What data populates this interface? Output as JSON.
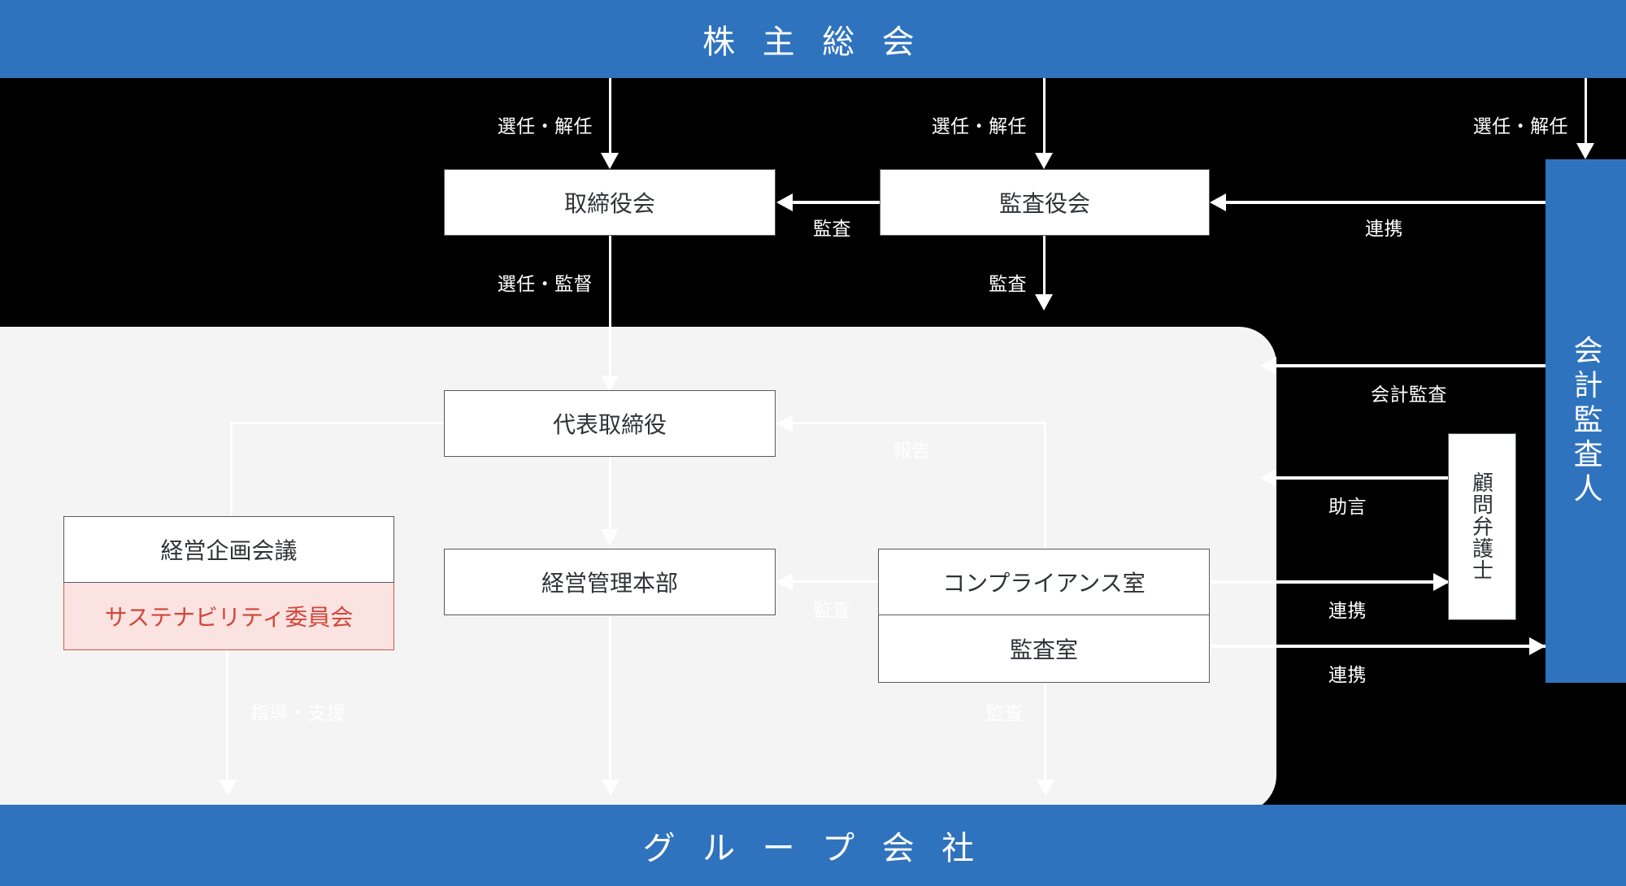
{
  "diagram": {
    "title_top": "株 主 総 会",
    "title_bottom": "グ ル ー プ 会 社",
    "accountant_panel": "会計監査人",
    "nodes": {
      "board_of_directors": "取締役会",
      "board_of_auditors": "監査役会",
      "representative_director": "代表取締役",
      "management_hq": "経営管理本部",
      "management_planning_meeting": "経営企画会議",
      "sustainability_committee": "サステナビリティ委員会",
      "compliance_office": "コンプライアンス室",
      "audit_office": "監査室",
      "advisory_lawyer": "顧問弁護士"
    },
    "edges": {
      "appoint_dismiss_board": "選任・解任",
      "appoint_dismiss_auditors": "選任・解任",
      "appoint_dismiss_accountant": "選任・解任",
      "audit_auditors_to_board": "監査",
      "cooperate_accountant_to_auditors": "連携",
      "appoint_supervise": "選任・監督",
      "audit_auditors_down": "監査",
      "accounting_audit": "会計監査",
      "advice": "助言",
      "cooperate_lawyer": "連携",
      "cooperate_accountant": "連携",
      "report": "報告",
      "audit_internal": "監査",
      "guidance_support": "指導・支援",
      "audit_to_group": "監査"
    },
    "colors": {
      "brand_blue": "#2f73be",
      "panel_grey": "#f4f4f4",
      "accent_red": "#d2453a",
      "accent_red_fill": "#fae3e1",
      "box_border": "#555a5e",
      "background": "#000000"
    }
  }
}
